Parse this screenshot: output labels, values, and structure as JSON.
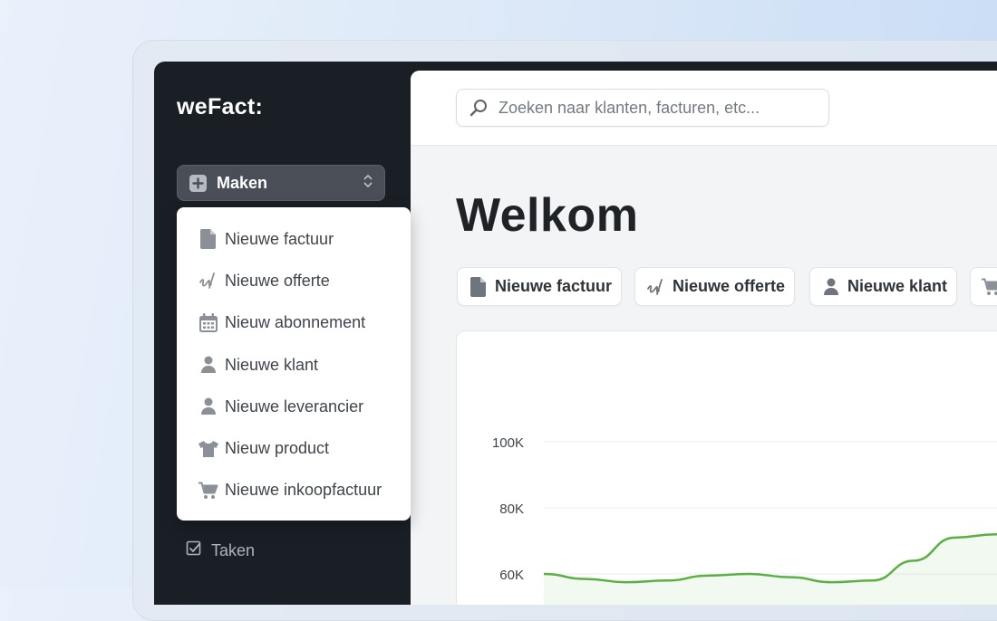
{
  "app": {
    "logo": "weFact:"
  },
  "sidebar": {
    "create_button": {
      "label": "Maken",
      "icon": "plus-square-icon"
    },
    "create_menu": [
      {
        "label": "Nieuwe factuur",
        "icon": "document-icon"
      },
      {
        "label": "Nieuwe offerte",
        "icon": "signature-icon"
      },
      {
        "label": "Nieuw abonnement",
        "icon": "calendar-icon"
      },
      {
        "label": "Nieuwe klant",
        "icon": "user-icon"
      },
      {
        "label": "Nieuwe leverancier",
        "icon": "user-icon"
      },
      {
        "label": "Nieuw product",
        "icon": "shirt-icon"
      },
      {
        "label": "Nieuwe inkoopfactuur",
        "icon": "cart-icon"
      }
    ],
    "items": [
      {
        "label": "Taken",
        "icon": "checkbox-icon"
      }
    ]
  },
  "search": {
    "placeholder": "Zoeken naar klanten, facturen, etc..."
  },
  "main": {
    "title": "Welkom",
    "quick_actions": [
      {
        "label": "Nieuwe factuur",
        "icon": "document-icon"
      },
      {
        "label": "Nieuwe offerte",
        "icon": "signature-icon"
      },
      {
        "label": "Nieuwe klant",
        "icon": "user-icon"
      },
      {
        "label": "",
        "icon": "cart-icon"
      }
    ]
  },
  "colors": {
    "accent_green": "#5bb043",
    "sidebar_bg": "#1a1f26"
  },
  "chart_data": {
    "type": "line",
    "y_ticks": [
      "100K",
      "80K",
      "60K"
    ],
    "ylim": [
      40000,
      110000
    ],
    "grid": true,
    "series": [
      {
        "values": [
          60000,
          58500,
          57500,
          58000,
          59500,
          60000,
          59000,
          57500,
          58000,
          64000,
          71000,
          72000,
          70500
        ]
      }
    ]
  }
}
